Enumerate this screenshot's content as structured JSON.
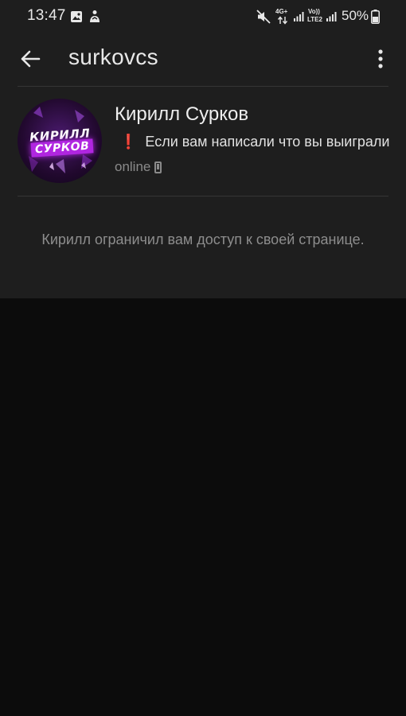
{
  "status_bar": {
    "time": "13:47",
    "battery_percent": "50%",
    "network_4g": "4G+",
    "volte_line1": "Vo))",
    "volte_line2": "LTE2"
  },
  "app_bar": {
    "title": "surkovcs"
  },
  "profile": {
    "name": "Кирилл Сурков",
    "status_text": "Если вам написали что вы выиграли",
    "online_text": "online",
    "avatar_text_line1": "КИРИЛЛ",
    "avatar_text_line2": "СУРКОВ"
  },
  "restricted": {
    "message": "Кирилл ограничил вам доступ к своей странице."
  },
  "colors": {
    "panel_bg": "#1e1e1e",
    "page_bg": "#0c0c0c",
    "accent_purple": "#b026e0",
    "warning_red": "#e53935"
  },
  "icons": {
    "status_left": [
      "image-icon",
      "notification-app-icon"
    ],
    "status_right": [
      "mute-icon",
      "network-arrows-icon",
      "signal-icon",
      "signal-icon-2",
      "battery-icon"
    ],
    "app_bar": [
      "back-arrow-icon",
      "more-vert-icon"
    ]
  }
}
